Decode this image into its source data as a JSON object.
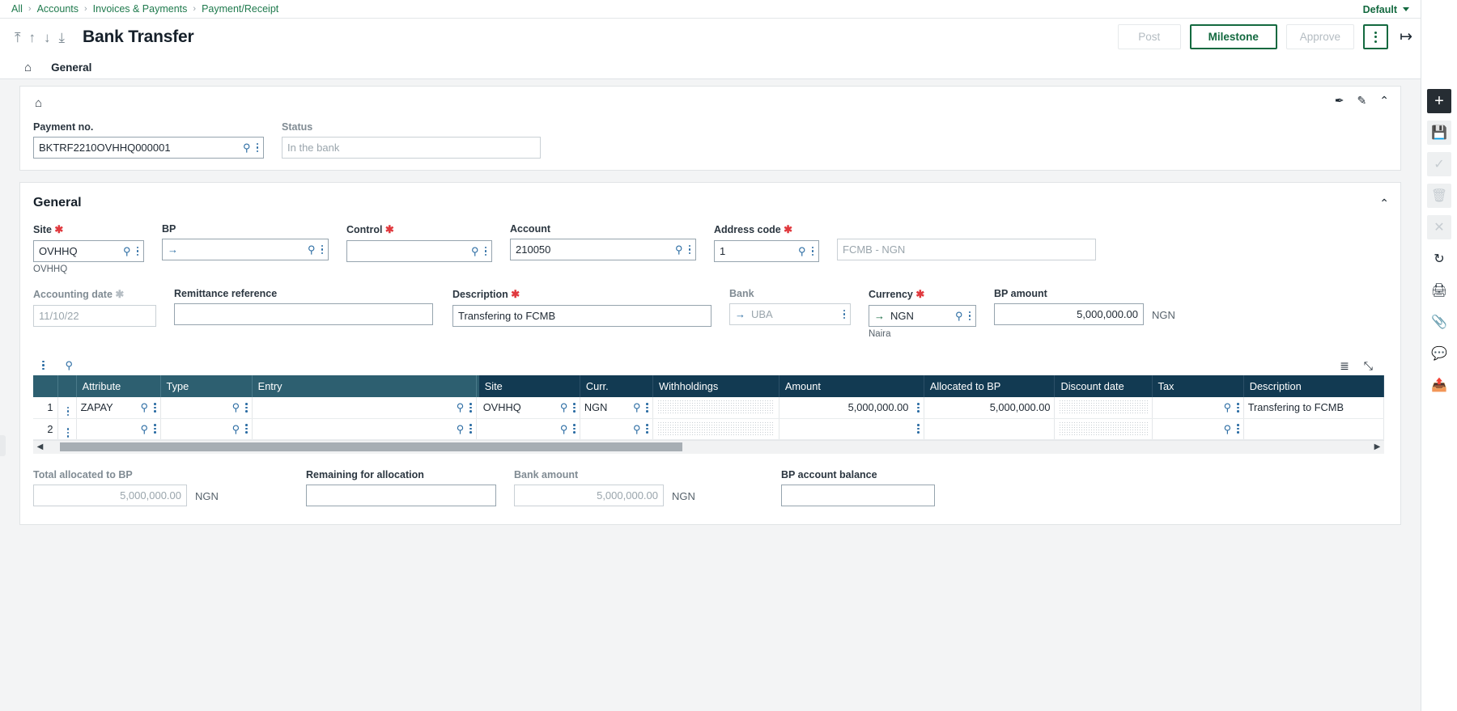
{
  "breadcrumb": {
    "items": [
      "All",
      "Accounts",
      "Invoices & Payments",
      "Payment/Receipt"
    ],
    "separator": "›"
  },
  "header": {
    "default_label": "Default",
    "title": "Bank Transfer",
    "nav_icons": [
      "first-arrow-icon",
      "prev-arrow-icon",
      "next-arrow-icon",
      "last-arrow-icon"
    ],
    "nav_glyphs": [
      "⤒",
      "↑",
      "↓",
      "⤓"
    ],
    "buttons": {
      "post": "Post",
      "milestone": "Milestone",
      "approve": "Approve"
    },
    "logout_glyph": "⇥"
  },
  "tabs": {
    "home_glyph": "⌂",
    "items": [
      {
        "label": "General",
        "active": true
      }
    ]
  },
  "top_card": {
    "home_glyph": "⌂",
    "pin_glyph": "✒",
    "pencil_glyph": "✎",
    "collapse_glyph": "⌃",
    "fields": {
      "payment_no": {
        "label": "Payment no.",
        "value": "BKTRF2210OVHHQ000001"
      },
      "status": {
        "label": "Status",
        "value": "",
        "placeholder": "In the bank"
      }
    }
  },
  "general": {
    "title": "General",
    "collapse_glyph": "⌃",
    "row1": {
      "site": {
        "label": "Site",
        "required": true,
        "value": "OVHHQ",
        "hint": "OVHHQ"
      },
      "bp": {
        "label": "BP",
        "required": false,
        "value": "",
        "arrow": "→"
      },
      "control": {
        "label": "Control",
        "required": true,
        "value": ""
      },
      "account": {
        "label": "Account",
        "required": false,
        "value": "210050"
      },
      "address_code": {
        "label": "Address code",
        "required": true,
        "value": "1"
      },
      "bank_name": {
        "label": "",
        "value": "",
        "placeholder": "FCMB - NGN"
      }
    },
    "row2": {
      "accounting_date": {
        "label": "Accounting date",
        "required": true,
        "required_muted": true,
        "value": "",
        "placeholder": "11/10/22"
      },
      "remittance_reference": {
        "label": "Remittance reference",
        "value": ""
      },
      "description": {
        "label": "Description",
        "required": true,
        "value": "Transfering to FCMB"
      },
      "bank": {
        "label": "Bank",
        "value": "",
        "placeholder": "UBA",
        "arrow": "→"
      },
      "currency": {
        "label": "Currency",
        "required": true,
        "value": "NGN",
        "arrow": "→",
        "hint": "Naira"
      },
      "bp_amount": {
        "label": "BP amount",
        "value": "5,000,000.00",
        "unit": "NGN"
      }
    },
    "grid": {
      "tool_kebab": "grid-menu-icon",
      "tool_search": "⌕",
      "layers_glyph": "≣",
      "expand_glyph": "⤡",
      "columns": [
        {
          "key": "attribute",
          "label": "Attribute",
          "shade": "light"
        },
        {
          "key": "type",
          "label": "Type",
          "shade": "light"
        },
        {
          "key": "entry",
          "label": "Entry",
          "shade": "light"
        },
        {
          "key": "site",
          "label": "Site",
          "shade": "dark"
        },
        {
          "key": "curr",
          "label": "Curr.",
          "shade": "dark"
        },
        {
          "key": "withholdings",
          "label": "Withholdings",
          "shade": "dark"
        },
        {
          "key": "amount",
          "label": "Amount",
          "shade": "dark"
        },
        {
          "key": "allocated_to_bp",
          "label": "Allocated to BP",
          "shade": "dark"
        },
        {
          "key": "discount_date",
          "label": "Discount date",
          "shade": "dark"
        },
        {
          "key": "tax",
          "label": "Tax",
          "shade": "dark"
        },
        {
          "key": "description",
          "label": "Description",
          "shade": "dark"
        }
      ],
      "rows": [
        {
          "index": "1",
          "attribute": "ZAPAY",
          "type": "",
          "entry": "",
          "site": "OVHHQ",
          "curr": "NGN",
          "withholdings": "",
          "amount": "5,000,000.00",
          "allocated_to_bp": "5,000,000.00",
          "discount_date": "",
          "tax": "",
          "description": "Transfering to FCMB"
        },
        {
          "index": "2",
          "attribute": "",
          "type": "",
          "entry": "",
          "site": "",
          "curr": "",
          "withholdings": "",
          "amount": "",
          "allocated_to_bp": "",
          "discount_date": "",
          "tax": "",
          "description": ""
        }
      ]
    },
    "totals": {
      "total_allocated": {
        "label": "Total allocated to BP",
        "value": "",
        "placeholder": "5,000,000.00",
        "unit": "NGN"
      },
      "remaining": {
        "label": "Remaining for allocation",
        "value": ""
      },
      "bank_amount": {
        "label": "Bank amount",
        "value": "",
        "placeholder": "5,000,000.00",
        "unit": "NGN"
      },
      "bp_account_balance": {
        "label": "BP account balance",
        "value": ""
      }
    }
  },
  "right_rail": [
    {
      "name": "add-icon",
      "glyph": "＋",
      "state": "active"
    },
    {
      "name": "save-icon",
      "glyph": "Ὃe",
      "state": "dim"
    },
    {
      "name": "check-icon",
      "glyph": "✓",
      "state": "dim"
    },
    {
      "name": "trash-icon",
      "glyph": "Ὕ1",
      "state": "dim"
    },
    {
      "name": "close-icon",
      "glyph": "✕",
      "state": "dim"
    },
    {
      "name": "refresh-icon",
      "glyph": "⟳",
      "state": "normal"
    },
    {
      "name": "print-icon",
      "glyph": "⎙",
      "state": "normal"
    },
    {
      "name": "attachment-icon",
      "glyph": "Ὄe",
      "state": "normal"
    },
    {
      "name": "comment-icon",
      "glyph": "Ὂc",
      "state": "normal"
    },
    {
      "name": "share-icon",
      "glyph": "⇧",
      "state": "normal"
    }
  ],
  "colors": {
    "breadcrumb_link": "#1f7a4d",
    "primary_green": "#13693f",
    "grid_header": "#2d5f70",
    "grid_header_dark": "#123a52",
    "required_star": "#e0393e"
  }
}
